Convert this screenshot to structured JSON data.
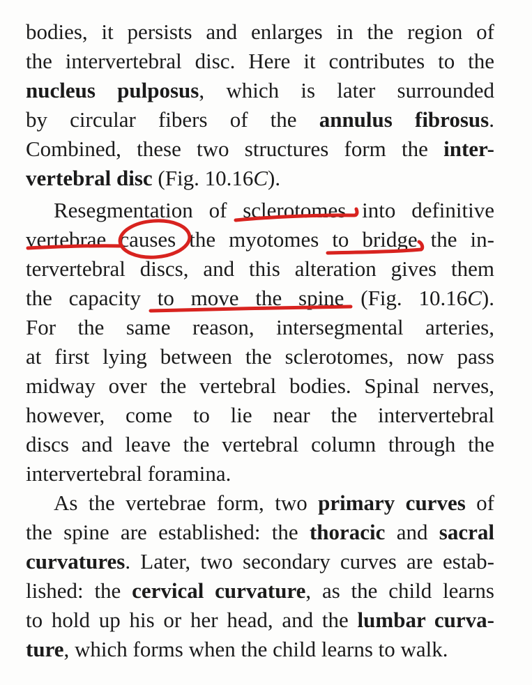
{
  "annotation_color": "#d8231f",
  "text_color": "#1b1b1b",
  "paragraphs": [
    {
      "lines": [
        [
          {
            "t": "bodies, it persists and enlarges in the region of"
          }
        ],
        [
          {
            "t": "the intervertebral disc. Here it contributes to the"
          }
        ],
        [
          {
            "t": "nucleus pulposus",
            "b": true
          },
          {
            "t": ", which is later surrounded"
          }
        ],
        [
          {
            "t": "by circular fibers of the "
          },
          {
            "t": "annulus fibrosus",
            "b": true
          },
          {
            "t": "."
          }
        ],
        [
          {
            "t": "Combined, these two structures form the "
          },
          {
            "t": "inter-",
            "b": true
          }
        ],
        [
          {
            "t": "vertebral disc",
            "b": true
          },
          {
            "t": " (Fig. 10.16"
          },
          {
            "t": "C",
            "i": true
          },
          {
            "t": ")."
          }
        ]
      ]
    },
    {
      "lines": [
        [
          {
            "t": "Resegmentation of sclerotomes into definitive"
          }
        ],
        [
          {
            "t": "vertebrae causes the myotomes to bridge the in-"
          }
        ],
        [
          {
            "t": "tervertebral discs, and this alteration gives them"
          }
        ],
        [
          {
            "t": "the capacity to move the spine (Fig. 10.16"
          },
          {
            "t": "C",
            "i": true
          },
          {
            "t": ")."
          }
        ],
        [
          {
            "t": "For the same reason, intersegmental arteries,"
          }
        ],
        [
          {
            "t": "at first lying between the sclerotomes, now pass"
          }
        ],
        [
          {
            "t": "midway over the vertebral bodies. Spinal nerves,"
          }
        ],
        [
          {
            "t": "however, come to lie near the intervertebral"
          }
        ],
        [
          {
            "t": "discs and leave the vertebral column through the"
          }
        ],
        [
          {
            "t": "intervertebral foramina."
          }
        ]
      ]
    },
    {
      "lines": [
        [
          {
            "t": "As the vertebrae form, two "
          },
          {
            "t": "primary curves",
            "b": true
          },
          {
            "t": " of"
          }
        ],
        [
          {
            "t": "the spine are established: the "
          },
          {
            "t": "thoracic",
            "b": true
          },
          {
            "t": " and "
          },
          {
            "t": "sacral",
            "b": true
          }
        ],
        [
          {
            "t": "curvatures",
            "b": true
          },
          {
            "t": ". Later, two secondary curves are estab-"
          }
        ],
        [
          {
            "t": "lished: the "
          },
          {
            "t": "cervical curvature",
            "b": true
          },
          {
            "t": ", as the child learns"
          }
        ],
        [
          {
            "t": "to hold up his or her head, and the "
          },
          {
            "t": "lumbar curva-",
            "b": true
          }
        ],
        [
          {
            "t": "ture",
            "b": true
          },
          {
            "t": ", which forms when the child learns to walk."
          }
        ]
      ]
    }
  ]
}
